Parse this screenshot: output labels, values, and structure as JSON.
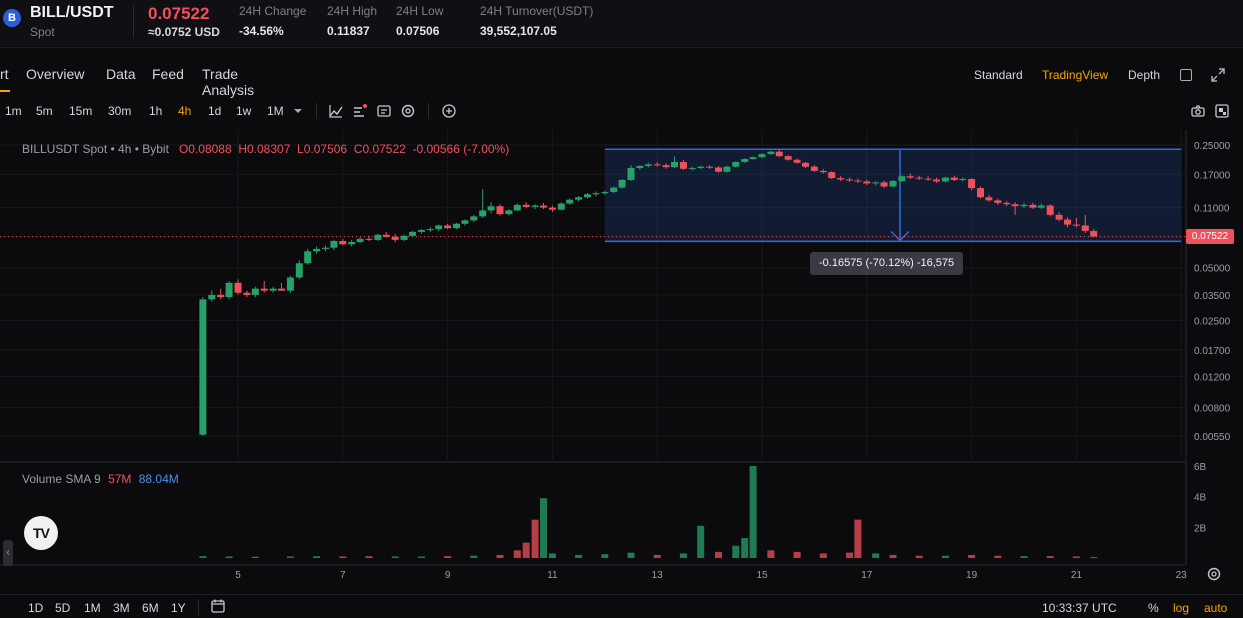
{
  "ticker": {
    "symbol": "BILL/USDT",
    "market": "Spot",
    "last_price": "0.07522",
    "usd_price": "≈0.0752 USD",
    "stats": [
      {
        "label": "24H Change",
        "value": "-34.56%"
      },
      {
        "label": "24H High",
        "value": "0.11837"
      },
      {
        "label": "24H Low",
        "value": "0.07506"
      },
      {
        "label": "24H Turnover(USDT)",
        "value": "39,552,107.05"
      }
    ]
  },
  "tabs": [
    "rt",
    "Overview",
    "Data",
    "Feed",
    "Trade Analysis"
  ],
  "view_modes": {
    "standard": "Standard",
    "tradingview": "TradingView",
    "depth": "Depth"
  },
  "timeframes": [
    "1m",
    "5m",
    "15m",
    "30m",
    "1h",
    "4h",
    "1d",
    "1w",
    "1M"
  ],
  "selected_timeframe": "4h",
  "legend": {
    "title": "BILLUSDT Spot • 4h • Bybit",
    "open": "O0.08088",
    "high": "H0.08307",
    "low": "L0.07506",
    "close": "C0.07522",
    "change": "-0.00566 (-7.00%)"
  },
  "volume_legend": {
    "label": "Volume SMA 9",
    "vol": "57M",
    "sma": "88.04M"
  },
  "measure_label": "-0.16575 (-70.12%) -16,575",
  "last_price_tag": "0.07522",
  "bottom": {
    "ranges": [
      "1D",
      "5D",
      "1M",
      "3M",
      "6M",
      "1Y"
    ],
    "clock": "10:33:37 UTC",
    "percent": "%",
    "log": "log",
    "auto": "auto"
  },
  "colors": {
    "up": "#26a269",
    "down": "#f0505b",
    "accent": "#f7a600",
    "measure": "#2f6ce0"
  },
  "chart_data": {
    "type": "candlestick",
    "title": "BILLUSDT Spot • 4h • Bybit",
    "y_scale": "log",
    "y_ticks": [
      0.25,
      0.17,
      0.11,
      0.075,
      0.05,
      0.035,
      0.025,
      0.017,
      0.012,
      0.008,
      0.0055
    ],
    "y_tick_labels": [
      "0.25000",
      "0.17000",
      "0.11000",
      "0.07522",
      "0.05000",
      "0.03500",
      "0.02500",
      "0.01700",
      "0.01200",
      "0.00800",
      "0.00550"
    ],
    "x_ticks": [
      "5",
      "7",
      "9",
      "11",
      "13",
      "15",
      "17",
      "19",
      "21",
      "23"
    ],
    "x_tick_days": [
      5,
      7,
      9,
      11,
      13,
      15,
      17,
      19,
      21,
      23
    ],
    "volume_ticks": [
      "6B",
      "4B",
      "2B"
    ],
    "volume_tick_values": [
      6,
      4,
      2
    ],
    "measure": {
      "from_price": 0.2364,
      "to_price": 0.0706,
      "from_day": 12.0,
      "to_day": 23.0
    },
    "candles": [
      {
        "day": 4.33,
        "o": 0.0056,
        "h": 0.034,
        "l": 0.0055,
        "c": 0.033
      },
      {
        "day": 4.5,
        "o": 0.033,
        "h": 0.037,
        "l": 0.032,
        "c": 0.035
      },
      {
        "day": 4.67,
        "o": 0.035,
        "h": 0.038,
        "l": 0.033,
        "c": 0.034
      },
      {
        "day": 4.83,
        "o": 0.034,
        "h": 0.042,
        "l": 0.033,
        "c": 0.041
      },
      {
        "day": 5.0,
        "o": 0.041,
        "h": 0.043,
        "l": 0.035,
        "c": 0.036
      },
      {
        "day": 5.17,
        "o": 0.036,
        "h": 0.037,
        "l": 0.034,
        "c": 0.035
      },
      {
        "day": 5.33,
        "o": 0.035,
        "h": 0.039,
        "l": 0.034,
        "c": 0.038
      },
      {
        "day": 5.5,
        "o": 0.038,
        "h": 0.042,
        "l": 0.036,
        "c": 0.037
      },
      {
        "day": 5.67,
        "o": 0.037,
        "h": 0.039,
        "l": 0.036,
        "c": 0.038
      },
      {
        "day": 5.83,
        "o": 0.038,
        "h": 0.041,
        "l": 0.037,
        "c": 0.037
      },
      {
        "day": 6.0,
        "o": 0.037,
        "h": 0.045,
        "l": 0.036,
        "c": 0.044
      },
      {
        "day": 6.17,
        "o": 0.044,
        "h": 0.055,
        "l": 0.043,
        "c": 0.053
      },
      {
        "day": 6.33,
        "o": 0.053,
        "h": 0.064,
        "l": 0.052,
        "c": 0.062
      },
      {
        "day": 6.5,
        "o": 0.062,
        "h": 0.066,
        "l": 0.06,
        "c": 0.064
      },
      {
        "day": 6.67,
        "o": 0.064,
        "h": 0.067,
        "l": 0.062,
        "c": 0.065
      },
      {
        "day": 6.83,
        "o": 0.065,
        "h": 0.072,
        "l": 0.063,
        "c": 0.071
      },
      {
        "day": 7.0,
        "o": 0.071,
        "h": 0.073,
        "l": 0.067,
        "c": 0.068
      },
      {
        "day": 7.17,
        "o": 0.068,
        "h": 0.072,
        "l": 0.066,
        "c": 0.07
      },
      {
        "day": 7.33,
        "o": 0.07,
        "h": 0.075,
        "l": 0.069,
        "c": 0.073
      },
      {
        "day": 7.5,
        "o": 0.073,
        "h": 0.076,
        "l": 0.071,
        "c": 0.072
      },
      {
        "day": 7.67,
        "o": 0.072,
        "h": 0.078,
        "l": 0.071,
        "c": 0.077
      },
      {
        "day": 7.83,
        "o": 0.077,
        "h": 0.08,
        "l": 0.074,
        "c": 0.075
      },
      {
        "day": 8.0,
        "o": 0.075,
        "h": 0.078,
        "l": 0.07,
        "c": 0.072
      },
      {
        "day": 8.17,
        "o": 0.072,
        "h": 0.077,
        "l": 0.071,
        "c": 0.076
      },
      {
        "day": 8.33,
        "o": 0.076,
        "h": 0.081,
        "l": 0.075,
        "c": 0.08
      },
      {
        "day": 8.5,
        "o": 0.08,
        "h": 0.083,
        "l": 0.078,
        "c": 0.082
      },
      {
        "day": 8.67,
        "o": 0.082,
        "h": 0.085,
        "l": 0.08,
        "c": 0.083
      },
      {
        "day": 8.83,
        "o": 0.083,
        "h": 0.088,
        "l": 0.081,
        "c": 0.087
      },
      {
        "day": 9.0,
        "o": 0.087,
        "h": 0.089,
        "l": 0.083,
        "c": 0.084
      },
      {
        "day": 9.17,
        "o": 0.084,
        "h": 0.09,
        "l": 0.083,
        "c": 0.089
      },
      {
        "day": 9.33,
        "o": 0.089,
        "h": 0.094,
        "l": 0.087,
        "c": 0.093
      },
      {
        "day": 9.5,
        "o": 0.093,
        "h": 0.1,
        "l": 0.091,
        "c": 0.098
      },
      {
        "day": 9.67,
        "o": 0.098,
        "h": 0.14,
        "l": 0.096,
        "c": 0.106
      },
      {
        "day": 9.83,
        "o": 0.106,
        "h": 0.118,
        "l": 0.102,
        "c": 0.112
      },
      {
        "day": 10.0,
        "o": 0.112,
        "h": 0.115,
        "l": 0.099,
        "c": 0.101
      },
      {
        "day": 10.17,
        "o": 0.101,
        "h": 0.108,
        "l": 0.099,
        "c": 0.106
      },
      {
        "day": 10.33,
        "o": 0.106,
        "h": 0.116,
        "l": 0.105,
        "c": 0.114
      },
      {
        "day": 10.5,
        "o": 0.114,
        "h": 0.118,
        "l": 0.109,
        "c": 0.111
      },
      {
        "day": 10.67,
        "o": 0.111,
        "h": 0.115,
        "l": 0.108,
        "c": 0.113
      },
      {
        "day": 10.83,
        "o": 0.113,
        "h": 0.117,
        "l": 0.108,
        "c": 0.11
      },
      {
        "day": 11.0,
        "o": 0.11,
        "h": 0.113,
        "l": 0.104,
        "c": 0.107
      },
      {
        "day": 11.17,
        "o": 0.107,
        "h": 0.118,
        "l": 0.106,
        "c": 0.116
      },
      {
        "day": 11.33,
        "o": 0.116,
        "h": 0.124,
        "l": 0.114,
        "c": 0.122
      },
      {
        "day": 11.5,
        "o": 0.122,
        "h": 0.128,
        "l": 0.119,
        "c": 0.126
      },
      {
        "day": 11.67,
        "o": 0.126,
        "h": 0.133,
        "l": 0.124,
        "c": 0.131
      },
      {
        "day": 11.83,
        "o": 0.131,
        "h": 0.136,
        "l": 0.127,
        "c": 0.133
      },
      {
        "day": 12.0,
        "o": 0.133,
        "h": 0.137,
        "l": 0.13,
        "c": 0.135
      },
      {
        "day": 12.17,
        "o": 0.135,
        "h": 0.145,
        "l": 0.133,
        "c": 0.143
      },
      {
        "day": 12.33,
        "o": 0.143,
        "h": 0.16,
        "l": 0.141,
        "c": 0.158
      },
      {
        "day": 12.5,
        "o": 0.158,
        "h": 0.192,
        "l": 0.156,
        "c": 0.185
      },
      {
        "day": 12.67,
        "o": 0.185,
        "h": 0.192,
        "l": 0.18,
        "c": 0.19
      },
      {
        "day": 12.83,
        "o": 0.19,
        "h": 0.198,
        "l": 0.186,
        "c": 0.194
      },
      {
        "day": 13.0,
        "o": 0.194,
        "h": 0.2,
        "l": 0.188,
        "c": 0.192
      },
      {
        "day": 13.17,
        "o": 0.192,
        "h": 0.197,
        "l": 0.183,
        "c": 0.187
      },
      {
        "day": 13.33,
        "o": 0.187,
        "h": 0.215,
        "l": 0.185,
        "c": 0.2
      },
      {
        "day": 13.5,
        "o": 0.2,
        "h": 0.205,
        "l": 0.18,
        "c": 0.183
      },
      {
        "day": 13.67,
        "o": 0.183,
        "h": 0.188,
        "l": 0.179,
        "c": 0.185
      },
      {
        "day": 13.83,
        "o": 0.185,
        "h": 0.19,
        "l": 0.182,
        "c": 0.188
      },
      {
        "day": 14.0,
        "o": 0.188,
        "h": 0.192,
        "l": 0.183,
        "c": 0.186
      },
      {
        "day": 14.17,
        "o": 0.186,
        "h": 0.19,
        "l": 0.174,
        "c": 0.176
      },
      {
        "day": 14.33,
        "o": 0.176,
        "h": 0.19,
        "l": 0.174,
        "c": 0.188
      },
      {
        "day": 14.5,
        "o": 0.188,
        "h": 0.202,
        "l": 0.186,
        "c": 0.2
      },
      {
        "day": 14.67,
        "o": 0.2,
        "h": 0.21,
        "l": 0.198,
        "c": 0.208
      },
      {
        "day": 14.83,
        "o": 0.208,
        "h": 0.215,
        "l": 0.206,
        "c": 0.213
      },
      {
        "day": 15.0,
        "o": 0.213,
        "h": 0.225,
        "l": 0.211,
        "c": 0.222
      },
      {
        "day": 15.17,
        "o": 0.222,
        "h": 0.232,
        "l": 0.22,
        "c": 0.229
      },
      {
        "day": 15.33,
        "o": 0.229,
        "h": 0.236,
        "l": 0.213,
        "c": 0.216
      },
      {
        "day": 15.5,
        "o": 0.216,
        "h": 0.219,
        "l": 0.204,
        "c": 0.206
      },
      {
        "day": 15.67,
        "o": 0.206,
        "h": 0.209,
        "l": 0.196,
        "c": 0.198
      },
      {
        "day": 15.83,
        "o": 0.198,
        "h": 0.2,
        "l": 0.185,
        "c": 0.188
      },
      {
        "day": 16.0,
        "o": 0.188,
        "h": 0.192,
        "l": 0.176,
        "c": 0.178
      },
      {
        "day": 16.17,
        "o": 0.178,
        "h": 0.182,
        "l": 0.172,
        "c": 0.175
      },
      {
        "day": 16.33,
        "o": 0.175,
        "h": 0.177,
        "l": 0.16,
        "c": 0.162
      },
      {
        "day": 16.5,
        "o": 0.162,
        "h": 0.166,
        "l": 0.156,
        "c": 0.159
      },
      {
        "day": 16.67,
        "o": 0.159,
        "h": 0.163,
        "l": 0.154,
        "c": 0.157
      },
      {
        "day": 16.83,
        "o": 0.157,
        "h": 0.161,
        "l": 0.152,
        "c": 0.155
      },
      {
        "day": 17.0,
        "o": 0.155,
        "h": 0.159,
        "l": 0.148,
        "c": 0.151
      },
      {
        "day": 17.17,
        "o": 0.151,
        "h": 0.156,
        "l": 0.147,
        "c": 0.153
      },
      {
        "day": 17.33,
        "o": 0.153,
        "h": 0.157,
        "l": 0.142,
        "c": 0.145
      },
      {
        "day": 17.5,
        "o": 0.145,
        "h": 0.158,
        "l": 0.143,
        "c": 0.156
      },
      {
        "day": 17.67,
        "o": 0.156,
        "h": 0.168,
        "l": 0.154,
        "c": 0.166
      },
      {
        "day": 17.83,
        "o": 0.166,
        "h": 0.172,
        "l": 0.16,
        "c": 0.163
      },
      {
        "day": 18.0,
        "o": 0.163,
        "h": 0.167,
        "l": 0.158,
        "c": 0.161
      },
      {
        "day": 18.17,
        "o": 0.161,
        "h": 0.166,
        "l": 0.156,
        "c": 0.159
      },
      {
        "day": 18.33,
        "o": 0.159,
        "h": 0.163,
        "l": 0.152,
        "c": 0.155
      },
      {
        "day": 18.5,
        "o": 0.155,
        "h": 0.165,
        "l": 0.153,
        "c": 0.163
      },
      {
        "day": 18.67,
        "o": 0.163,
        "h": 0.167,
        "l": 0.156,
        "c": 0.158
      },
      {
        "day": 18.83,
        "o": 0.158,
        "h": 0.163,
        "l": 0.155,
        "c": 0.16
      },
      {
        "day": 19.0,
        "o": 0.16,
        "h": 0.162,
        "l": 0.138,
        "c": 0.142
      },
      {
        "day": 19.17,
        "o": 0.142,
        "h": 0.145,
        "l": 0.124,
        "c": 0.126
      },
      {
        "day": 19.33,
        "o": 0.126,
        "h": 0.13,
        "l": 0.119,
        "c": 0.121
      },
      {
        "day": 19.5,
        "o": 0.121,
        "h": 0.124,
        "l": 0.114,
        "c": 0.117
      },
      {
        "day": 19.67,
        "o": 0.117,
        "h": 0.12,
        "l": 0.112,
        "c": 0.115
      },
      {
        "day": 19.83,
        "o": 0.115,
        "h": 0.118,
        "l": 0.1,
        "c": 0.112
      },
      {
        "day": 20.0,
        "o": 0.112,
        "h": 0.117,
        "l": 0.109,
        "c": 0.114
      },
      {
        "day": 20.17,
        "o": 0.114,
        "h": 0.117,
        "l": 0.108,
        "c": 0.11
      },
      {
        "day": 20.33,
        "o": 0.11,
        "h": 0.116,
        "l": 0.108,
        "c": 0.113
      },
      {
        "day": 20.5,
        "o": 0.113,
        "h": 0.115,
        "l": 0.098,
        "c": 0.1
      },
      {
        "day": 20.67,
        "o": 0.1,
        "h": 0.104,
        "l": 0.092,
        "c": 0.094
      },
      {
        "day": 20.83,
        "o": 0.094,
        "h": 0.097,
        "l": 0.085,
        "c": 0.088
      },
      {
        "day": 21.0,
        "o": 0.088,
        "h": 0.096,
        "l": 0.085,
        "c": 0.087
      },
      {
        "day": 21.17,
        "o": 0.087,
        "h": 0.1,
        "l": 0.079,
        "c": 0.081
      },
      {
        "day": 21.33,
        "o": 0.0809,
        "h": 0.0831,
        "l": 0.0751,
        "c": 0.0752
      }
    ],
    "volume": [
      {
        "day": 4.33,
        "v": 0.12,
        "up": true
      },
      {
        "day": 4.83,
        "v": 0.1,
        "up": true
      },
      {
        "day": 5.33,
        "v": 0.08,
        "up": false
      },
      {
        "day": 6.0,
        "v": 0.1,
        "up": true
      },
      {
        "day": 6.5,
        "v": 0.12,
        "up": true
      },
      {
        "day": 7.0,
        "v": 0.1,
        "up": false
      },
      {
        "day": 7.5,
        "v": 0.12,
        "up": false
      },
      {
        "day": 8.0,
        "v": 0.1,
        "up": true
      },
      {
        "day": 8.5,
        "v": 0.1,
        "up": true
      },
      {
        "day": 9.0,
        "v": 0.12,
        "up": false
      },
      {
        "day": 9.5,
        "v": 0.15,
        "up": true
      },
      {
        "day": 10.0,
        "v": 0.2,
        "up": false
      },
      {
        "day": 10.33,
        "v": 0.5,
        "up": false
      },
      {
        "day": 10.5,
        "v": 1.0,
        "up": false
      },
      {
        "day": 10.67,
        "v": 2.5,
        "up": false
      },
      {
        "day": 10.83,
        "v": 3.9,
        "up": true
      },
      {
        "day": 11.0,
        "v": 0.3,
        "up": true
      },
      {
        "day": 11.5,
        "v": 0.2,
        "up": true
      },
      {
        "day": 12.0,
        "v": 0.25,
        "up": true
      },
      {
        "day": 12.5,
        "v": 0.35,
        "up": true
      },
      {
        "day": 13.0,
        "v": 0.2,
        "up": false
      },
      {
        "day": 13.5,
        "v": 0.3,
        "up": true
      },
      {
        "day": 13.83,
        "v": 2.1,
        "up": true
      },
      {
        "day": 14.17,
        "v": 0.4,
        "up": false
      },
      {
        "day": 14.5,
        "v": 0.8,
        "up": true
      },
      {
        "day": 14.67,
        "v": 1.3,
        "up": true
      },
      {
        "day": 14.83,
        "v": 6.0,
        "up": true
      },
      {
        "day": 15.17,
        "v": 0.5,
        "up": false
      },
      {
        "day": 15.67,
        "v": 0.4,
        "up": false
      },
      {
        "day": 16.17,
        "v": 0.3,
        "up": false
      },
      {
        "day": 16.67,
        "v": 0.35,
        "up": false
      },
      {
        "day": 16.83,
        "v": 2.5,
        "up": false
      },
      {
        "day": 17.17,
        "v": 0.3,
        "up": true
      },
      {
        "day": 17.5,
        "v": 0.2,
        "up": false
      },
      {
        "day": 18.0,
        "v": 0.15,
        "up": false
      },
      {
        "day": 18.5,
        "v": 0.15,
        "up": true
      },
      {
        "day": 19.0,
        "v": 0.2,
        "up": false
      },
      {
        "day": 19.5,
        "v": 0.15,
        "up": false
      },
      {
        "day": 20.0,
        "v": 0.12,
        "up": true
      },
      {
        "day": 20.5,
        "v": 0.12,
        "up": false
      },
      {
        "day": 21.0,
        "v": 0.1,
        "up": false
      },
      {
        "day": 21.33,
        "v": 0.06,
        "up": false
      }
    ]
  }
}
